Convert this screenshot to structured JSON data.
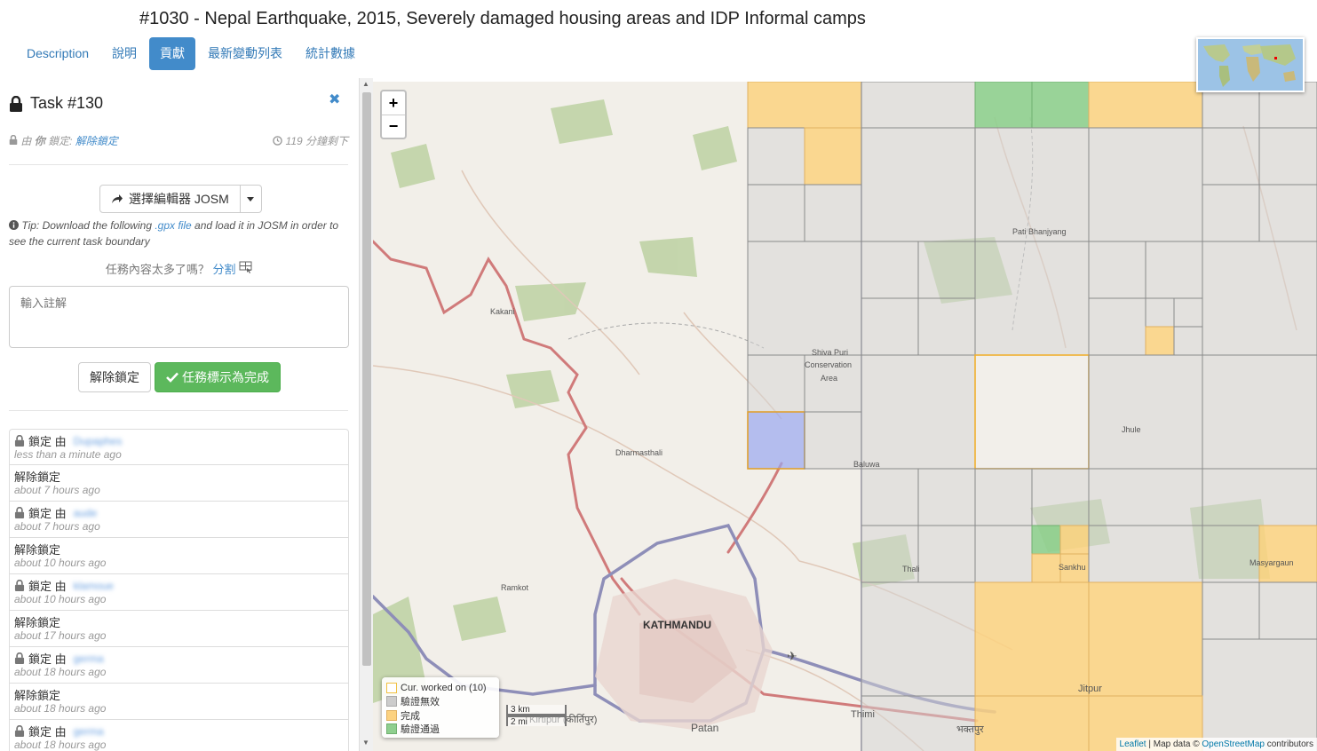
{
  "header": {
    "title": "#1030 - Nepal Earthquake, 2015, Severely damaged housing areas and IDP Informal camps",
    "tabs": [
      {
        "label": "Description",
        "active": false
      },
      {
        "label": "說明",
        "active": false
      },
      {
        "label": "貢獻",
        "active": true
      },
      {
        "label": "最新變動列表",
        "active": false
      },
      {
        "label": "統計數據",
        "active": false
      }
    ]
  },
  "task": {
    "title": "Task #130",
    "locked_by_prefix": "由",
    "locked_by_user": "你",
    "locked_suffix": "鎖定:",
    "unlock_link": "解除鎖定",
    "time_left": "119 分鐘剩下",
    "editor_button": "選擇編輯器 JOSM",
    "tip_prefix": "Tip: Download the following ",
    "tip_link": ".gpx file",
    "tip_suffix": " and load it in JOSM in order to see the current task boundary",
    "split_question": "任務內容太多了嗎？",
    "split_link": "分割",
    "comment_placeholder": "輸入註解",
    "unlock_button": "解除鎖定",
    "done_button": "任務標示為完成"
  },
  "history": [
    {
      "action": "鎖定 由",
      "user": "Dupaphes",
      "time": "less than a minute ago",
      "locked": true
    },
    {
      "action": "解除鎖定",
      "user": "",
      "time": "about 7 hours ago",
      "locked": false
    },
    {
      "action": "鎖定 由",
      "user": "aude",
      "time": "about 7 hours ago",
      "locked": true
    },
    {
      "action": "解除鎖定",
      "user": "",
      "time": "about 10 hours ago",
      "locked": false
    },
    {
      "action": "鎖定 由",
      "user": "klamoue",
      "time": "about 10 hours ago",
      "locked": true
    },
    {
      "action": "解除鎖定",
      "user": "",
      "time": "about 17 hours ago",
      "locked": false
    },
    {
      "action": "鎖定 由",
      "user": "germa",
      "time": "about 18 hours ago",
      "locked": true
    },
    {
      "action": "解除鎖定",
      "user": "",
      "time": "about 18 hours ago",
      "locked": false
    },
    {
      "action": "鎖定 由",
      "user": "germa",
      "time": "about 18 hours ago",
      "locked": true
    }
  ],
  "map": {
    "zoom_in": "+",
    "zoom_out": "−",
    "legend": [
      {
        "label": "Cur. worked on (10)",
        "color": "#ffffff",
        "border": "#f0c040"
      },
      {
        "label": "驗證無效",
        "color": "#cccccc",
        "border": "#aaaaaa"
      },
      {
        "label": "完成",
        "color": "#fcd280",
        "border": "#e0b060"
      },
      {
        "label": "驗證通過",
        "color": "#8fcf8f",
        "border": "#70b070"
      }
    ],
    "scale_km": "3 km",
    "scale_mi": "2 mi",
    "attribution_leaflet": "Leaflet",
    "attribution_mid": " | Map data © ",
    "attribution_osm": "OpenStreetMap",
    "attribution_end": " contributors",
    "places": [
      {
        "name": "Kakani"
      },
      {
        "name": "Dharmasthali"
      },
      {
        "name": "Ramkot"
      },
      {
        "name": "KATHMANDU"
      },
      {
        "name": "Patan"
      },
      {
        "name": "Kirtipur (कीर्तिपुर)"
      },
      {
        "name": "Thimi"
      },
      {
        "name": "Pati Bhanjyang"
      },
      {
        "name": "Shiva Puri"
      },
      {
        "name": "Conservation"
      },
      {
        "name": "Area"
      },
      {
        "name": "Baluwa"
      },
      {
        "name": "Jhule"
      },
      {
        "name": "Sankhu"
      },
      {
        "name": "Masyargaun"
      },
      {
        "name": "Thali"
      },
      {
        "name": "Jitpur"
      },
      {
        "name": "भक्तपुर"
      }
    ]
  }
}
